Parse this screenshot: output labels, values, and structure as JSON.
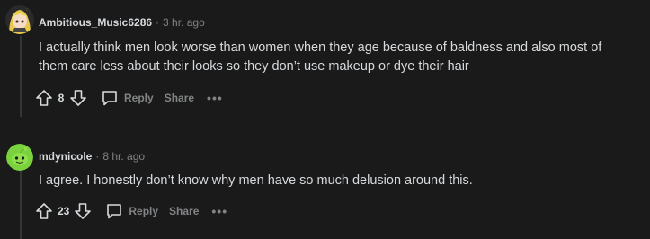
{
  "comments": [
    {
      "username": "Ambitious_Music6286",
      "separator": "·",
      "time": "3 hr. ago",
      "body": "I actually think men look worse than women when they age because of baldness and also most of them care less about their looks so they don’t use makeup or dye their hair",
      "score": "8",
      "reply_label": "Reply",
      "share_label": "Share",
      "more_label": "•••",
      "avatar_icon": "anime-girl-avatar-icon"
    },
    {
      "username": "mdynicole",
      "separator": "·",
      "time": "8 hr. ago",
      "body": "I agree. I honestly don’t know why men have so much delusion around this.",
      "score": "23",
      "reply_label": "Reply",
      "share_label": "Share",
      "more_label": "•••",
      "avatar_icon": "green-snoo-avatar-icon"
    }
  ],
  "colors": {
    "background": "#1a1a1b",
    "text": "#d7dadc",
    "muted": "#818384",
    "thread_line": "#343536"
  }
}
